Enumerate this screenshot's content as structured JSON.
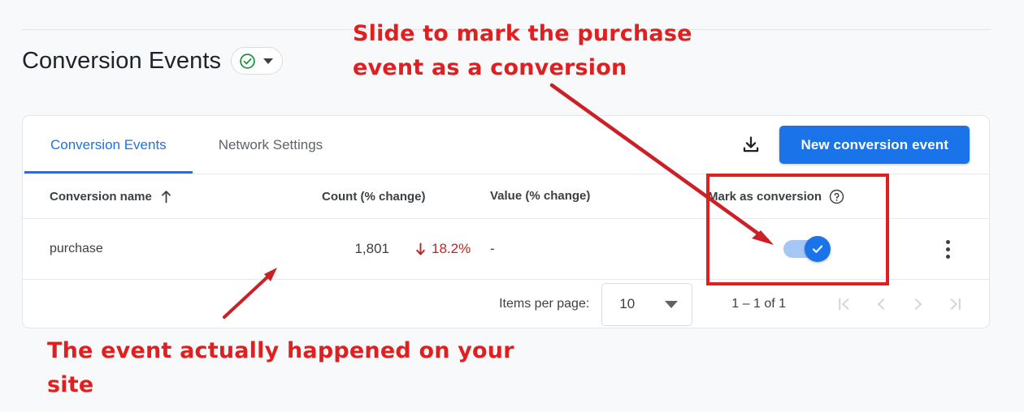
{
  "page": {
    "title": "Conversion Events",
    "status_badge": {
      "icon": "check-circle-icon",
      "caret": "chevron-down-icon"
    }
  },
  "card": {
    "tabs": [
      {
        "label": "Conversion Events",
        "active": true
      },
      {
        "label": "Network Settings",
        "active": false
      }
    ],
    "toolbar": {
      "download_icon": "download-icon",
      "new_event_button": "New conversion event"
    },
    "table": {
      "headers": [
        {
          "label": "Conversion name",
          "sort": "ascending",
          "icon": "arrow-up-icon"
        },
        {
          "label": "Count (% change)"
        },
        {
          "label": "Value (% change)"
        },
        {
          "label": "Mark as conversion",
          "icon": "help-circle-icon"
        }
      ],
      "rows": [
        {
          "name": "purchase",
          "count": "1,801",
          "change": "18.2%",
          "change_direction": "down",
          "value": "-",
          "mark_as_conversion": true,
          "menu_icon": "more-vert-icon"
        }
      ]
    },
    "paginator": {
      "items_per_page_label": "Items per page:",
      "items_per_page_value": "10",
      "range_label": "1 – 1 of 1",
      "buttons": [
        {
          "name": "first-page",
          "glyph": "|<"
        },
        {
          "name": "previous-page",
          "glyph": "<"
        },
        {
          "name": "next-page",
          "glyph": ">"
        },
        {
          "name": "last-page",
          "glyph": ">|"
        }
      ]
    }
  },
  "annotations": {
    "top": "Slide to mark the purchase\nevent as a conversion",
    "bottom": "The event actually happened on your\nsite",
    "color": "#e02020",
    "highlight_box": "mark-as-conversion-column"
  },
  "colors": {
    "accent_blue": "#1a73e8",
    "annotation_red": "#e02020",
    "negative_red": "#c5221f",
    "badge_green": "#1e8e3e",
    "page_background": "#f7f9fa"
  }
}
